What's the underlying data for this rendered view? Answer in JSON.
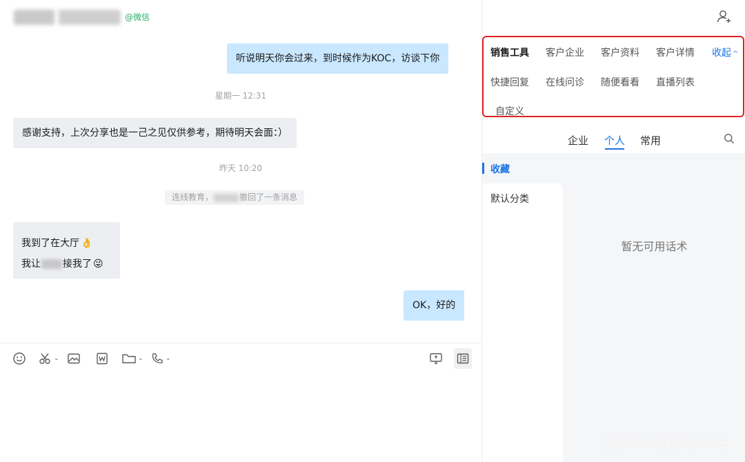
{
  "chat": {
    "source_tag": "@微信",
    "messages": {
      "m1": "听说明天你会过来，到时候作为KOC，访谈下你",
      "m2": "感谢支持，上次分享也是一己之见仅供参考，期待明天会面：）",
      "m3_line1": "我到了在大厅",
      "m3_line2_a": "我让",
      "m3_line2_b": "接我了",
      "m4": "OK，好的"
    },
    "emoji": {
      "e1": "👌",
      "e2": "😜"
    },
    "times": {
      "t1": "星期一 12:31",
      "t2": "昨天 10:20"
    },
    "recall": {
      "prefix": "连线教育，",
      "suffix": "撤回了一条消息"
    }
  },
  "toolbar": {
    "icons": [
      "emoji-icon",
      "scissors-icon",
      "image-icon",
      "word-doc-icon",
      "folder-icon",
      "phone-icon",
      "screen-share-icon",
      "sidebar-panel-icon"
    ]
  },
  "side_panel": {
    "tools": {
      "sales_tools": "销售工具",
      "customer_company": "客户企业",
      "customer_profile": "客户资料",
      "customer_detail": "客户详情",
      "collapse": "收起",
      "quick_reply": "快捷回复",
      "online_consult": "在线问诊",
      "browse": "随便看看",
      "live_list": "直播列表",
      "custom": "自定义"
    },
    "tabs": {
      "enterprise": "企业",
      "personal": "个人",
      "common": "常用"
    },
    "categories": {
      "favorites": "收藏",
      "default": "默认分类"
    },
    "empty_text": "暂无可用话术"
  },
  "watermark": "百家号/伙伴云平台",
  "colors": {
    "accent": "#1a73e8",
    "outgoing_bubble": "#c9e7ff",
    "incoming_bubble": "#eceef1",
    "highlight_border": "#e02020",
    "wechat_green": "#2aae67"
  }
}
